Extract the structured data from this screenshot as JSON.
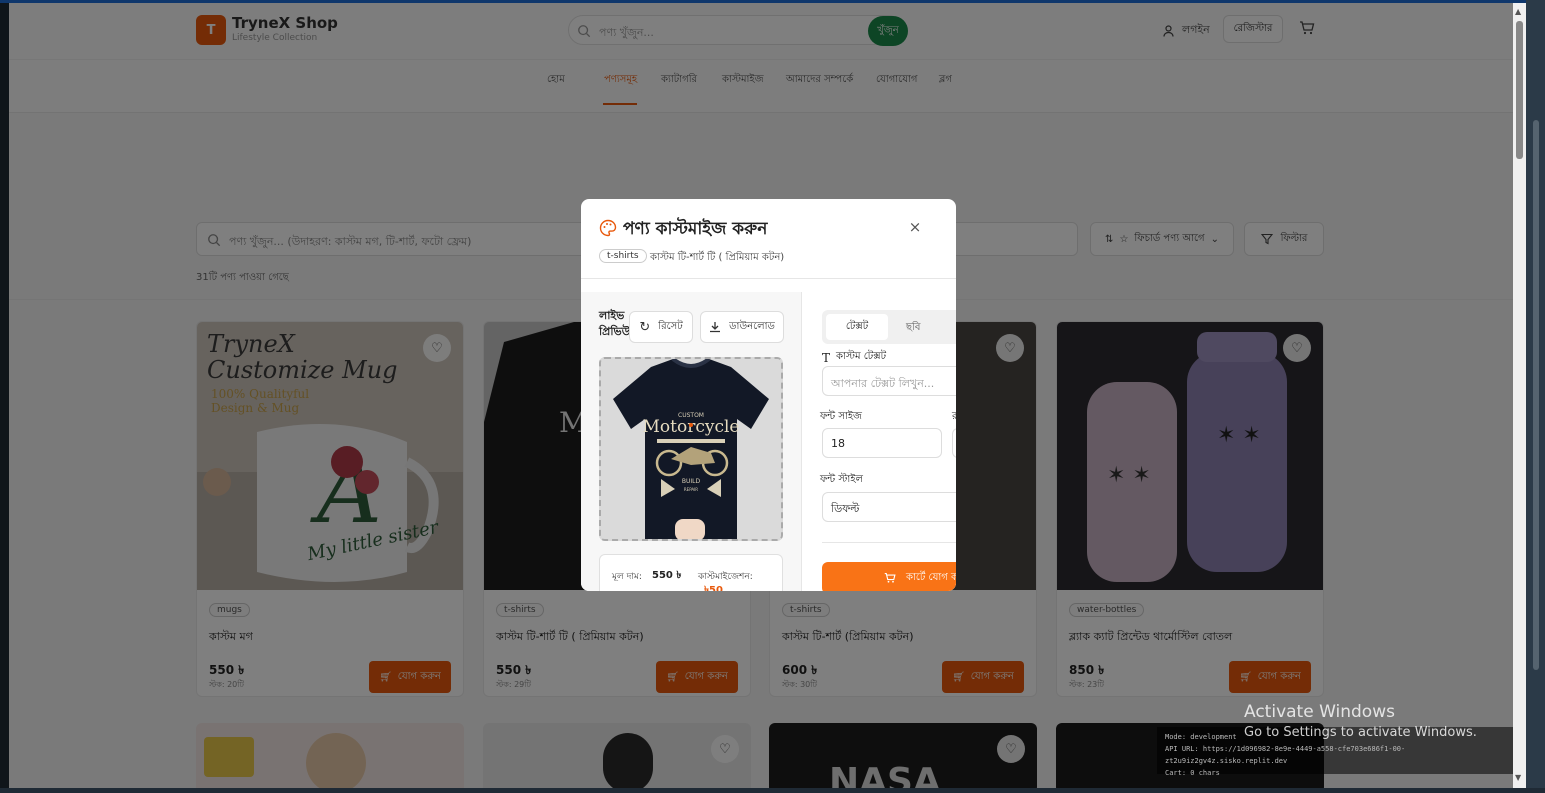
{
  "header": {
    "logo_letter": "T",
    "brand_name": "TryneX Shop",
    "brand_sub": "Lifestyle Collection",
    "search_placeholder": "পণ্য খুঁজুন...",
    "search_button": "খুঁজুন",
    "login": "লগইন",
    "register": "রেজিস্টার"
  },
  "nav": [
    "হোম",
    "পণ্যসমূহ",
    "ক্যাটাগরি",
    "কাস্টমাইজ",
    "আমাদের সম্পর্কে",
    "যোগাযোগ",
    "ব্লগ"
  ],
  "filters": {
    "search_placeholder": "পণ্য খুঁজুন... (উদাহরণ: কাস্টম মগ, টি-শার্ট, ফটো ফ্রেম)",
    "sort_label": "ফিচার্ড পণ্য আগে",
    "filter_label": "ফিল্টার",
    "result_count": "31টি পণ্য পাওয়া গেছে"
  },
  "products": [
    {
      "tag": "mugs",
      "title": "কাস্টম মগ",
      "price": "550 ৳",
      "stock": "স্টক: 20টি",
      "add": "যোগ করুন"
    },
    {
      "tag": "t-shirts",
      "title": "কাস্টম টি-শার্ট টি ( প্রিমিয়াম কটন)",
      "price": "550 ৳",
      "stock": "স্টক: 29টি",
      "add": "যোগ করুন"
    },
    {
      "tag": "t-shirts",
      "title": "কাস্টম টি-শার্ট (প্রিমিয়াম কটন)",
      "price": "600 ৳",
      "stock": "স্টক: 30টি",
      "add": "যোগ করুন"
    },
    {
      "tag": "water-bottles",
      "title": "ব্ল্যাক ক্যাট প্রিন্টেড থার্মোস্টিল বোতল",
      "price": "850 ৳",
      "stock": "স্টক: 23টি",
      "add": "যোগ করুন"
    }
  ],
  "mug_image_text": {
    "line1": "TryneX",
    "line2": "Customize Mug",
    "line3": "100% Qualityful",
    "line4": "Design & Mug",
    "line5": "My little sister"
  },
  "modal": {
    "title": "পণ্য কাস্টমাইজ করুন",
    "tag": "t-shirts",
    "product_name": "কাস্টম টি-শার্ট টি ( প্রিমিয়াম কটন)",
    "live_preview": "লাইভ প্রিভিউ",
    "reset": "রিসেট",
    "download": "ডাউনলোড",
    "shirt_text_1": "CUSTOM",
    "shirt_text_2": "Motorcycle",
    "shirt_text_3": "BUILD",
    "shirt_text_4": "REPAIR",
    "base_price_label": "মূল দাম:",
    "base_price": "550 ৳",
    "custom_label": "কাস্টমাইজেশন:",
    "custom_price": "৳50",
    "tab_text": "টেক্সট",
    "tab_image": "ছবি",
    "custom_text_label": "কাস্টম টেক্সট",
    "custom_text_placeholder": "আপনার টেক্সট লিখুন...",
    "font_size_label": "ফন্ট সাইজ",
    "font_color_label_partial": "র",
    "font_size_value": "18",
    "font_style_label": "ফন্ট স্টাইল",
    "font_style_value": "ডিফল্ট",
    "add_to_cart": "কার্টে যোগ ক"
  },
  "overlay_text": {
    "activate_title": "Activate Windows",
    "activate_sub": "Go to Settings to activate Windows.",
    "dev_mode": "Mode: development",
    "dev_api": "API URL: https://1d096982-8e9e-4449-a558-cfe703e686f1-00-zt2u9iz2gv4z.sisko.replit.dev",
    "dev_cart": "Cart: 0 chars"
  },
  "colors": {
    "accent": "#e8590c",
    "search_green": "#1a8a4a",
    "cart_orange": "#f97316"
  }
}
